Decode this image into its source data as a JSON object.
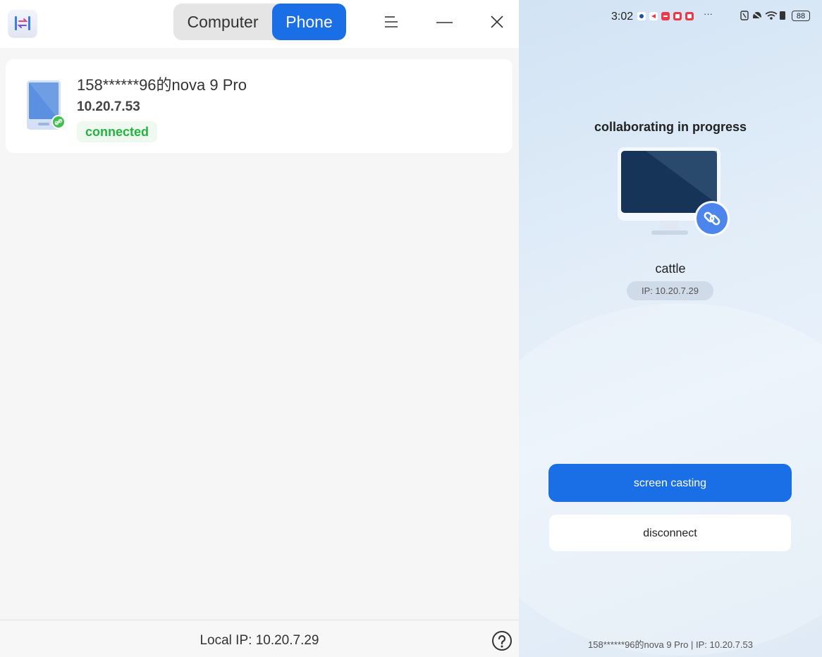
{
  "desktop": {
    "tabs": [
      {
        "label": "Computer",
        "selected": false
      },
      {
        "label": "Phone",
        "selected": true
      }
    ],
    "window_controls": [
      "menu-icon",
      "minimize-icon",
      "close-icon"
    ],
    "device": {
      "name": "158******96的nova 9 Pro",
      "ip": "10.20.7.53",
      "status": "connected"
    },
    "footer": {
      "local_ip": "Local IP: 10.20.7.29",
      "help_icon": "help-icon"
    },
    "colors": {
      "accent": "#1a6fe6",
      "connected": "#24b33e"
    }
  },
  "phone": {
    "status_bar": {
      "time": "3:02",
      "ellipsis": "···",
      "battery": "88"
    },
    "title": "collaborating in progress",
    "pc_name": "cattle",
    "pc_ip": "IP:  10.20.7.29",
    "buttons": {
      "screen_casting": "screen casting",
      "disconnect": "disconnect"
    },
    "footer": "158******96的nova 9 Pro | IP:   10.20.7.53"
  }
}
